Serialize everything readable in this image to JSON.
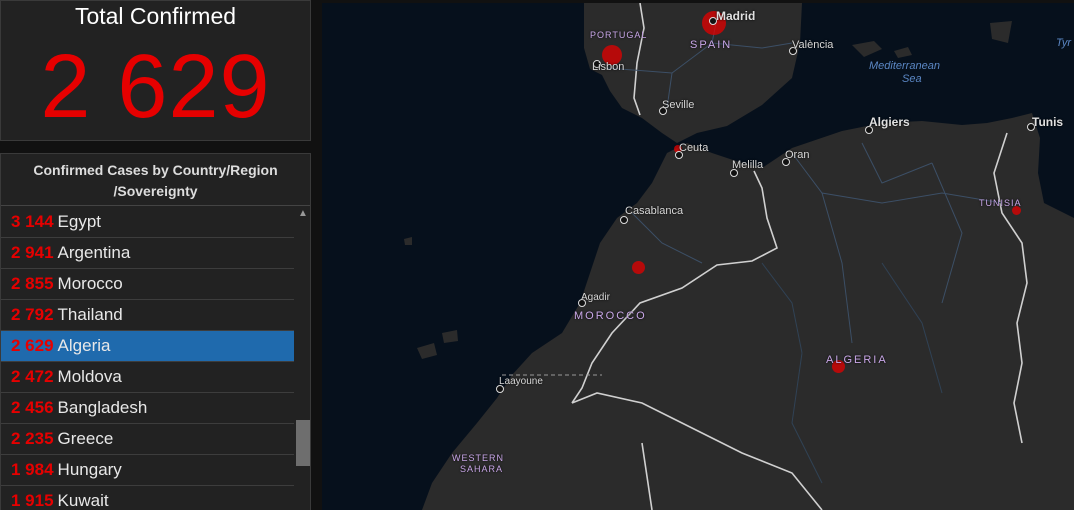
{
  "total": {
    "title": "Total Confirmed",
    "value": "2 629"
  },
  "list": {
    "header_line1": "Confirmed Cases by Country/Region",
    "header_line2": "/Sovereignty",
    "rows": [
      {
        "num": "3 144",
        "name": "Egypt"
      },
      {
        "num": "2 941",
        "name": "Argentina"
      },
      {
        "num": "2 855",
        "name": "Morocco"
      },
      {
        "num": "2 792",
        "name": "Thailand"
      },
      {
        "num": "2 629",
        "name": "Algeria"
      },
      {
        "num": "2 472",
        "name": "Moldova"
      },
      {
        "num": "2 456",
        "name": "Bangladesh"
      },
      {
        "num": "2 235",
        "name": "Greece"
      },
      {
        "num": "1 984",
        "name": "Hungary"
      },
      {
        "num": "1 915",
        "name": "Kuwait"
      }
    ],
    "selected_index": 4
  },
  "map": {
    "cities": {
      "madrid": "Madrid",
      "valencia": "València",
      "lisbon": "Lisbon",
      "seville": "Seville",
      "ceuta": "Ceuta",
      "melilla": "Melilla",
      "oran": "Oran",
      "algiers": "Algiers",
      "tunis": "Tunis",
      "casablanca": "Casablanca",
      "agadir": "Agadir",
      "laayoune": "Laayoune"
    },
    "countries": {
      "portugal": "PORTUGAL",
      "spain": "SPAIN",
      "morocco": "MOROCCO",
      "algeria": "ALGERIA",
      "tunisia": "TUNISIA",
      "western_sahara_1": "WESTERN",
      "western_sahara_2": "SAHARA"
    },
    "seas": {
      "med_1": "Mediterranean",
      "med_2": "Sea",
      "tyr": "Tyr"
    },
    "colors": {
      "land": "#2b2b2b",
      "water": "#06101c",
      "case_circle": "#e60000",
      "selected_row": "#1f6aad"
    }
  }
}
